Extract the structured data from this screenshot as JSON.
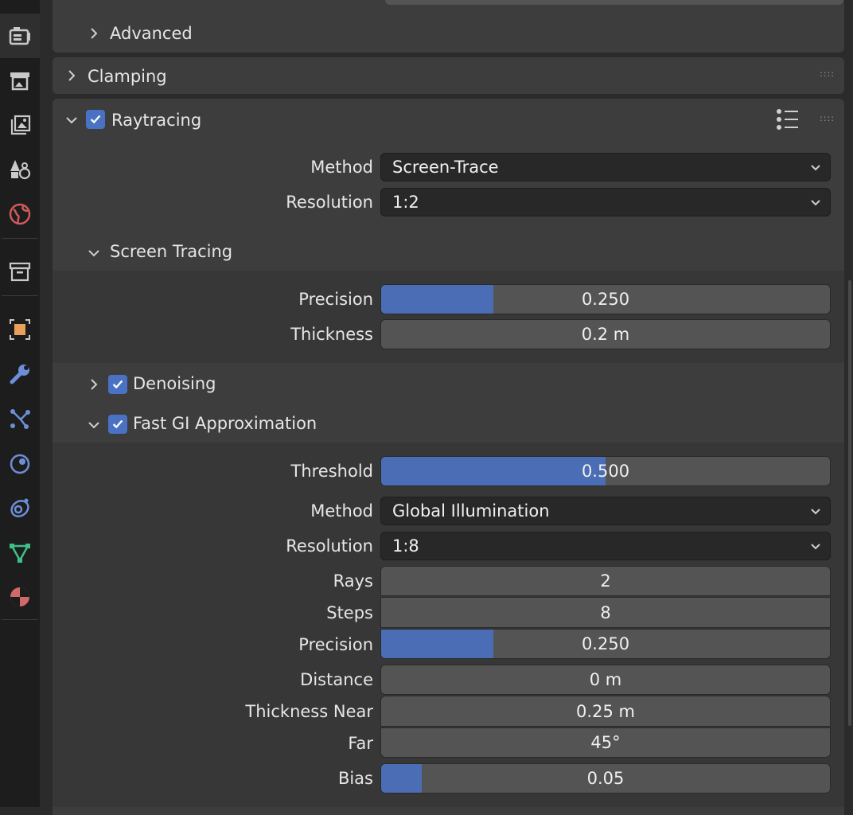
{
  "sidebar": {
    "tabs": [
      {
        "name": "render-properties-icon",
        "color": "#c9c9c9",
        "active": true
      },
      {
        "name": "output-properties-icon",
        "color": "#c9c9c9"
      },
      {
        "name": "view-layer-properties-icon",
        "color": "#c9c9c9"
      },
      {
        "name": "scene-properties-icon",
        "color": "#c9c9c9"
      },
      {
        "name": "world-properties-icon",
        "color": "#d05a5a"
      },
      {
        "name": "collection-properties-icon",
        "color": "#c9c9c9"
      },
      {
        "name": "object-properties-icon",
        "color": "#e8a05a"
      },
      {
        "name": "modifier-properties-icon",
        "color": "#6d8fd8"
      },
      {
        "name": "particle-properties-icon",
        "color": "#6d8fd8"
      },
      {
        "name": "physics-properties-icon",
        "color": "#6d8fd8"
      },
      {
        "name": "object-constraint-properties-icon",
        "color": "#6d8fd8"
      },
      {
        "name": "object-data-properties-icon",
        "color": "#3dbf8a"
      },
      {
        "name": "material-properties-icon",
        "color": "#d06a6a"
      }
    ]
  },
  "panels": {
    "advanced": {
      "label": "Advanced"
    },
    "clamping": {
      "label": "Clamping"
    },
    "raytracing": {
      "label": "Raytracing",
      "method_label": "Method",
      "method_value": "Screen-Trace",
      "resolution_label": "Resolution",
      "resolution_value": "1:2"
    },
    "screen_tracing": {
      "label": "Screen Tracing",
      "precision_label": "Precision",
      "precision_value": "0.250",
      "precision_fraction": 0.25,
      "thickness_label": "Thickness",
      "thickness_value": "0.2 m"
    },
    "denoising": {
      "label": "Denoising"
    },
    "fast_gi": {
      "label": "Fast GI Approximation",
      "threshold_label": "Threshold",
      "threshold_value": "0.500",
      "threshold_fraction": 0.5,
      "method_label": "Method",
      "method_value": "Global Illumination",
      "resolution_label": "Resolution",
      "resolution_value": "1:8",
      "rays_label": "Rays",
      "rays_value": "2",
      "steps_label": "Steps",
      "steps_value": "8",
      "precision_label": "Precision",
      "precision_value": "0.250",
      "precision_fraction": 0.25,
      "distance_label": "Distance",
      "distance_value": "0 m",
      "thickness_near_label": "Thickness Near",
      "thickness_near_value": "0.25 m",
      "far_label": "Far",
      "far_value": "45°",
      "bias_label": "Bias",
      "bias_value": "0.05",
      "bias_fraction": 0.09
    }
  },
  "colors": {
    "accent": "#4a6db5",
    "checkbox": "#4a72c4"
  }
}
